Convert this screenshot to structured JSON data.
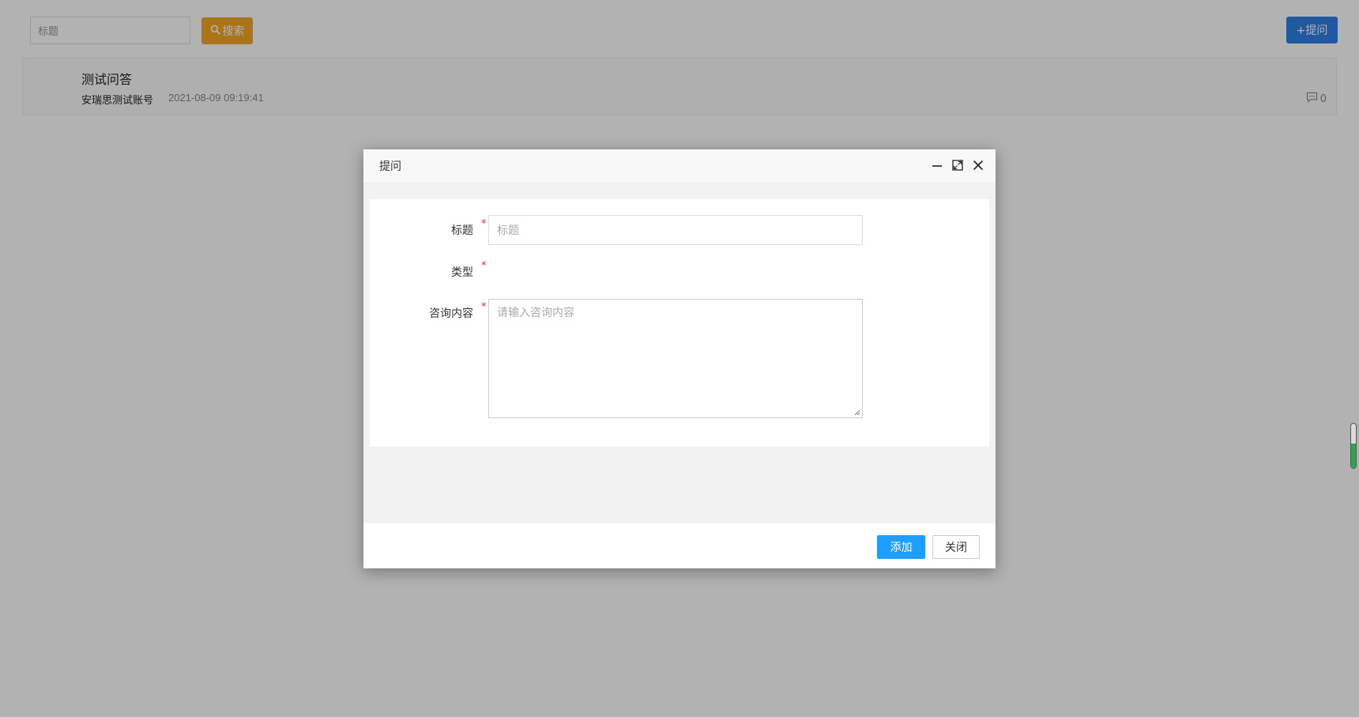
{
  "search": {
    "placeholder": "标题",
    "button_label": "搜索"
  },
  "header": {
    "ask_button_label": "+提问"
  },
  "qa_list": [
    {
      "title": "测试问答",
      "author": "安瑞思测试账号",
      "time": "2021-08-09 09:19:41",
      "comment_count": "0"
    }
  ],
  "modal": {
    "title": "提问",
    "fields": {
      "title_label": "标题",
      "title_placeholder": "标题",
      "type_label": "类型",
      "content_label": "咨询内容",
      "content_placeholder": "请输入咨询内容",
      "required_mark": "*"
    },
    "add_label": "添加",
    "close_label": "关闭"
  },
  "colors": {
    "search_button": "#f5a623",
    "ask_button": "#2f7fe8",
    "add_button": "#1e9fff",
    "required": "#e33333"
  },
  "icons": [
    "search-icon",
    "comment-icon",
    "minimize-icon",
    "maximize-icon",
    "close-icon"
  ]
}
